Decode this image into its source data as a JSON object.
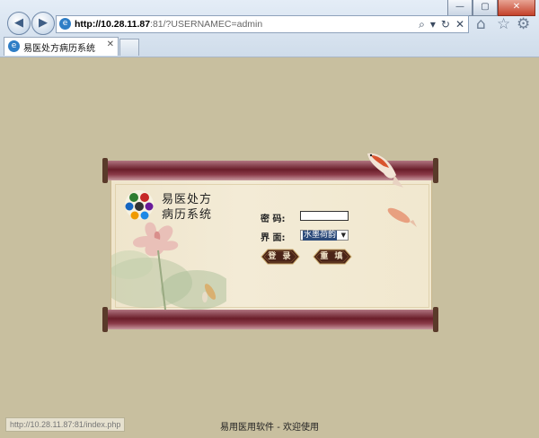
{
  "browser": {
    "address": {
      "host": "http://10.28.11.87",
      "rest": ":81/?USERNAMEC=admin"
    },
    "tab": {
      "title": "易医处方病历系统"
    },
    "window_buttons": [
      "—",
      "▢",
      "✕"
    ]
  },
  "app": {
    "title_line1": "易医处方",
    "title_line2": "病历系统",
    "password_label": "密  码:",
    "theme_label": "界  面:",
    "theme_selected": "水墨荷韵",
    "login_button": "登 录",
    "reset_button": "重 填"
  },
  "footer": {
    "text": "易用医用软件 - 欢迎使用"
  },
  "status_bar": {
    "url": "http://10.28.11.87:81/index.php"
  },
  "colors": {
    "page_bg": "#c8bf9f",
    "scroll_rod": "#6a1e2a",
    "paper": "#f3ebd6",
    "button": "#4a2418"
  }
}
